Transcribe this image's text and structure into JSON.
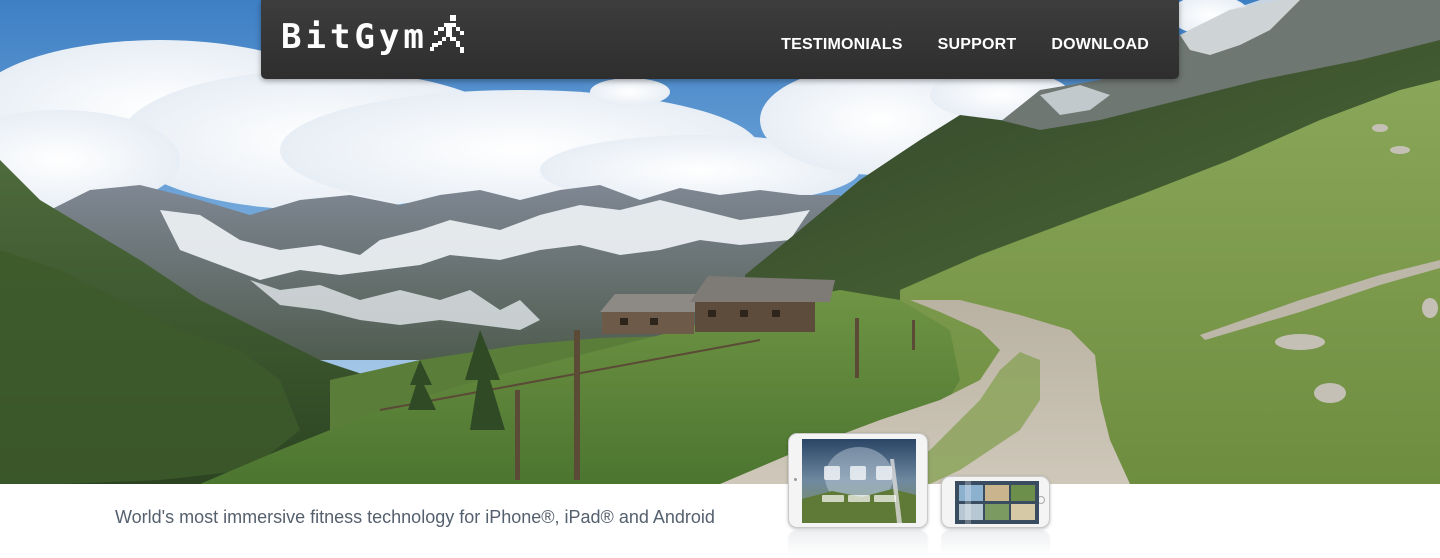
{
  "brand": {
    "name": "BitGym"
  },
  "nav": {
    "items": [
      {
        "label": "TESTIMONIALS"
      },
      {
        "label": "SUPPORT"
      },
      {
        "label": "DOWNLOAD"
      }
    ]
  },
  "hero": {
    "image": "alpine-valley-trail"
  },
  "footer": {
    "tagline": "World's most immersive fitness technology for iPhone®, iPad® and Android"
  },
  "devices": {
    "ipad_app": {
      "tiles": [
        "",
        "",
        "",
        "",
        "",
        ""
      ],
      "icon": "app-menu-screen"
    },
    "iphone_app": {
      "icon": "video-gallery-screen"
    }
  },
  "colors": {
    "navbar": "#333333",
    "nav_text": "#ffffff",
    "tagline_text": "#55606e"
  }
}
